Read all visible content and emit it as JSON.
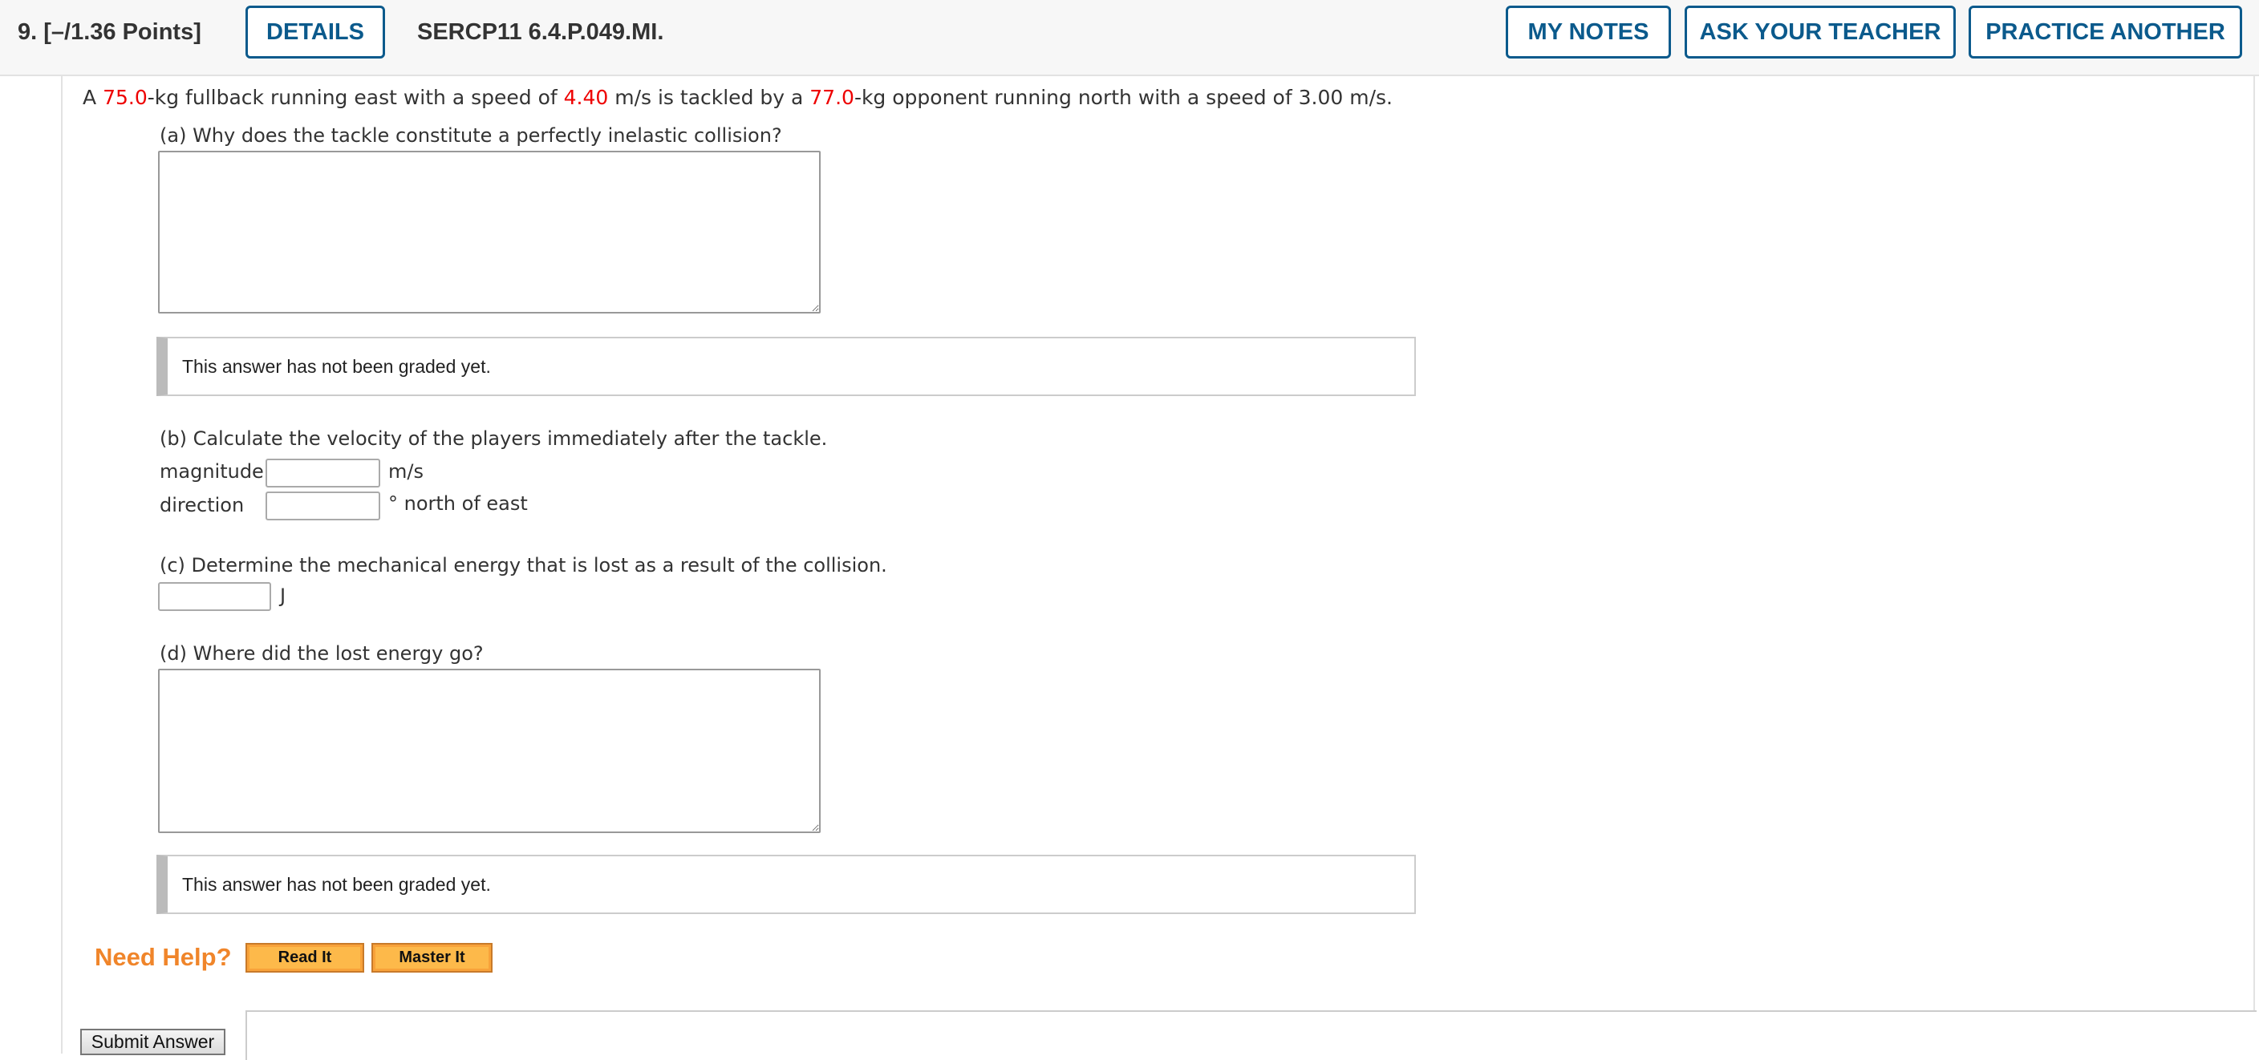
{
  "header": {
    "question_label": "9. [–/1.36 Points]",
    "details_label": "DETAILS",
    "problem_id": "SERCP11 6.4.P.049.MI.",
    "my_notes_label": "MY NOTES",
    "ask_teacher_label": "ASK YOUR TEACHER",
    "practice_label": "PRACTICE ANOTHER",
    "accent_color": "#0b5a8c"
  },
  "problem": {
    "t1": "A ",
    "mass1": "75.0",
    "t2": "-kg fullback running east with a speed of ",
    "speed1": "4.40",
    "t3": " m/s is tackled by a ",
    "mass2": "77.0",
    "t4": "-kg opponent running north with a speed of 3.00 m/s.",
    "highlight_color": "#ee0000"
  },
  "part_a": {
    "question": "(a) Why does the tackle constitute a perfectly inelastic collision?",
    "answer": "",
    "status": "This answer has not been graded yet."
  },
  "part_b": {
    "question": "(b) Calculate the velocity of the players immediately after the tackle.",
    "magnitude_label": "magnitude",
    "magnitude_value": "",
    "magnitude_unit": "m/s",
    "direction_label": "direction",
    "direction_value": "",
    "direction_unit": "° north of east"
  },
  "part_c": {
    "question": "(c) Determine the mechanical energy that is lost as a result of the collision.",
    "value": "",
    "unit": "J"
  },
  "part_d": {
    "question": "(d) Where did the lost energy go?",
    "answer": "",
    "status": "This answer has not been graded yet."
  },
  "help": {
    "label": "Need Help?",
    "read_it": "Read It",
    "master_it": "Master It"
  },
  "submit_label": "Submit Answer"
}
